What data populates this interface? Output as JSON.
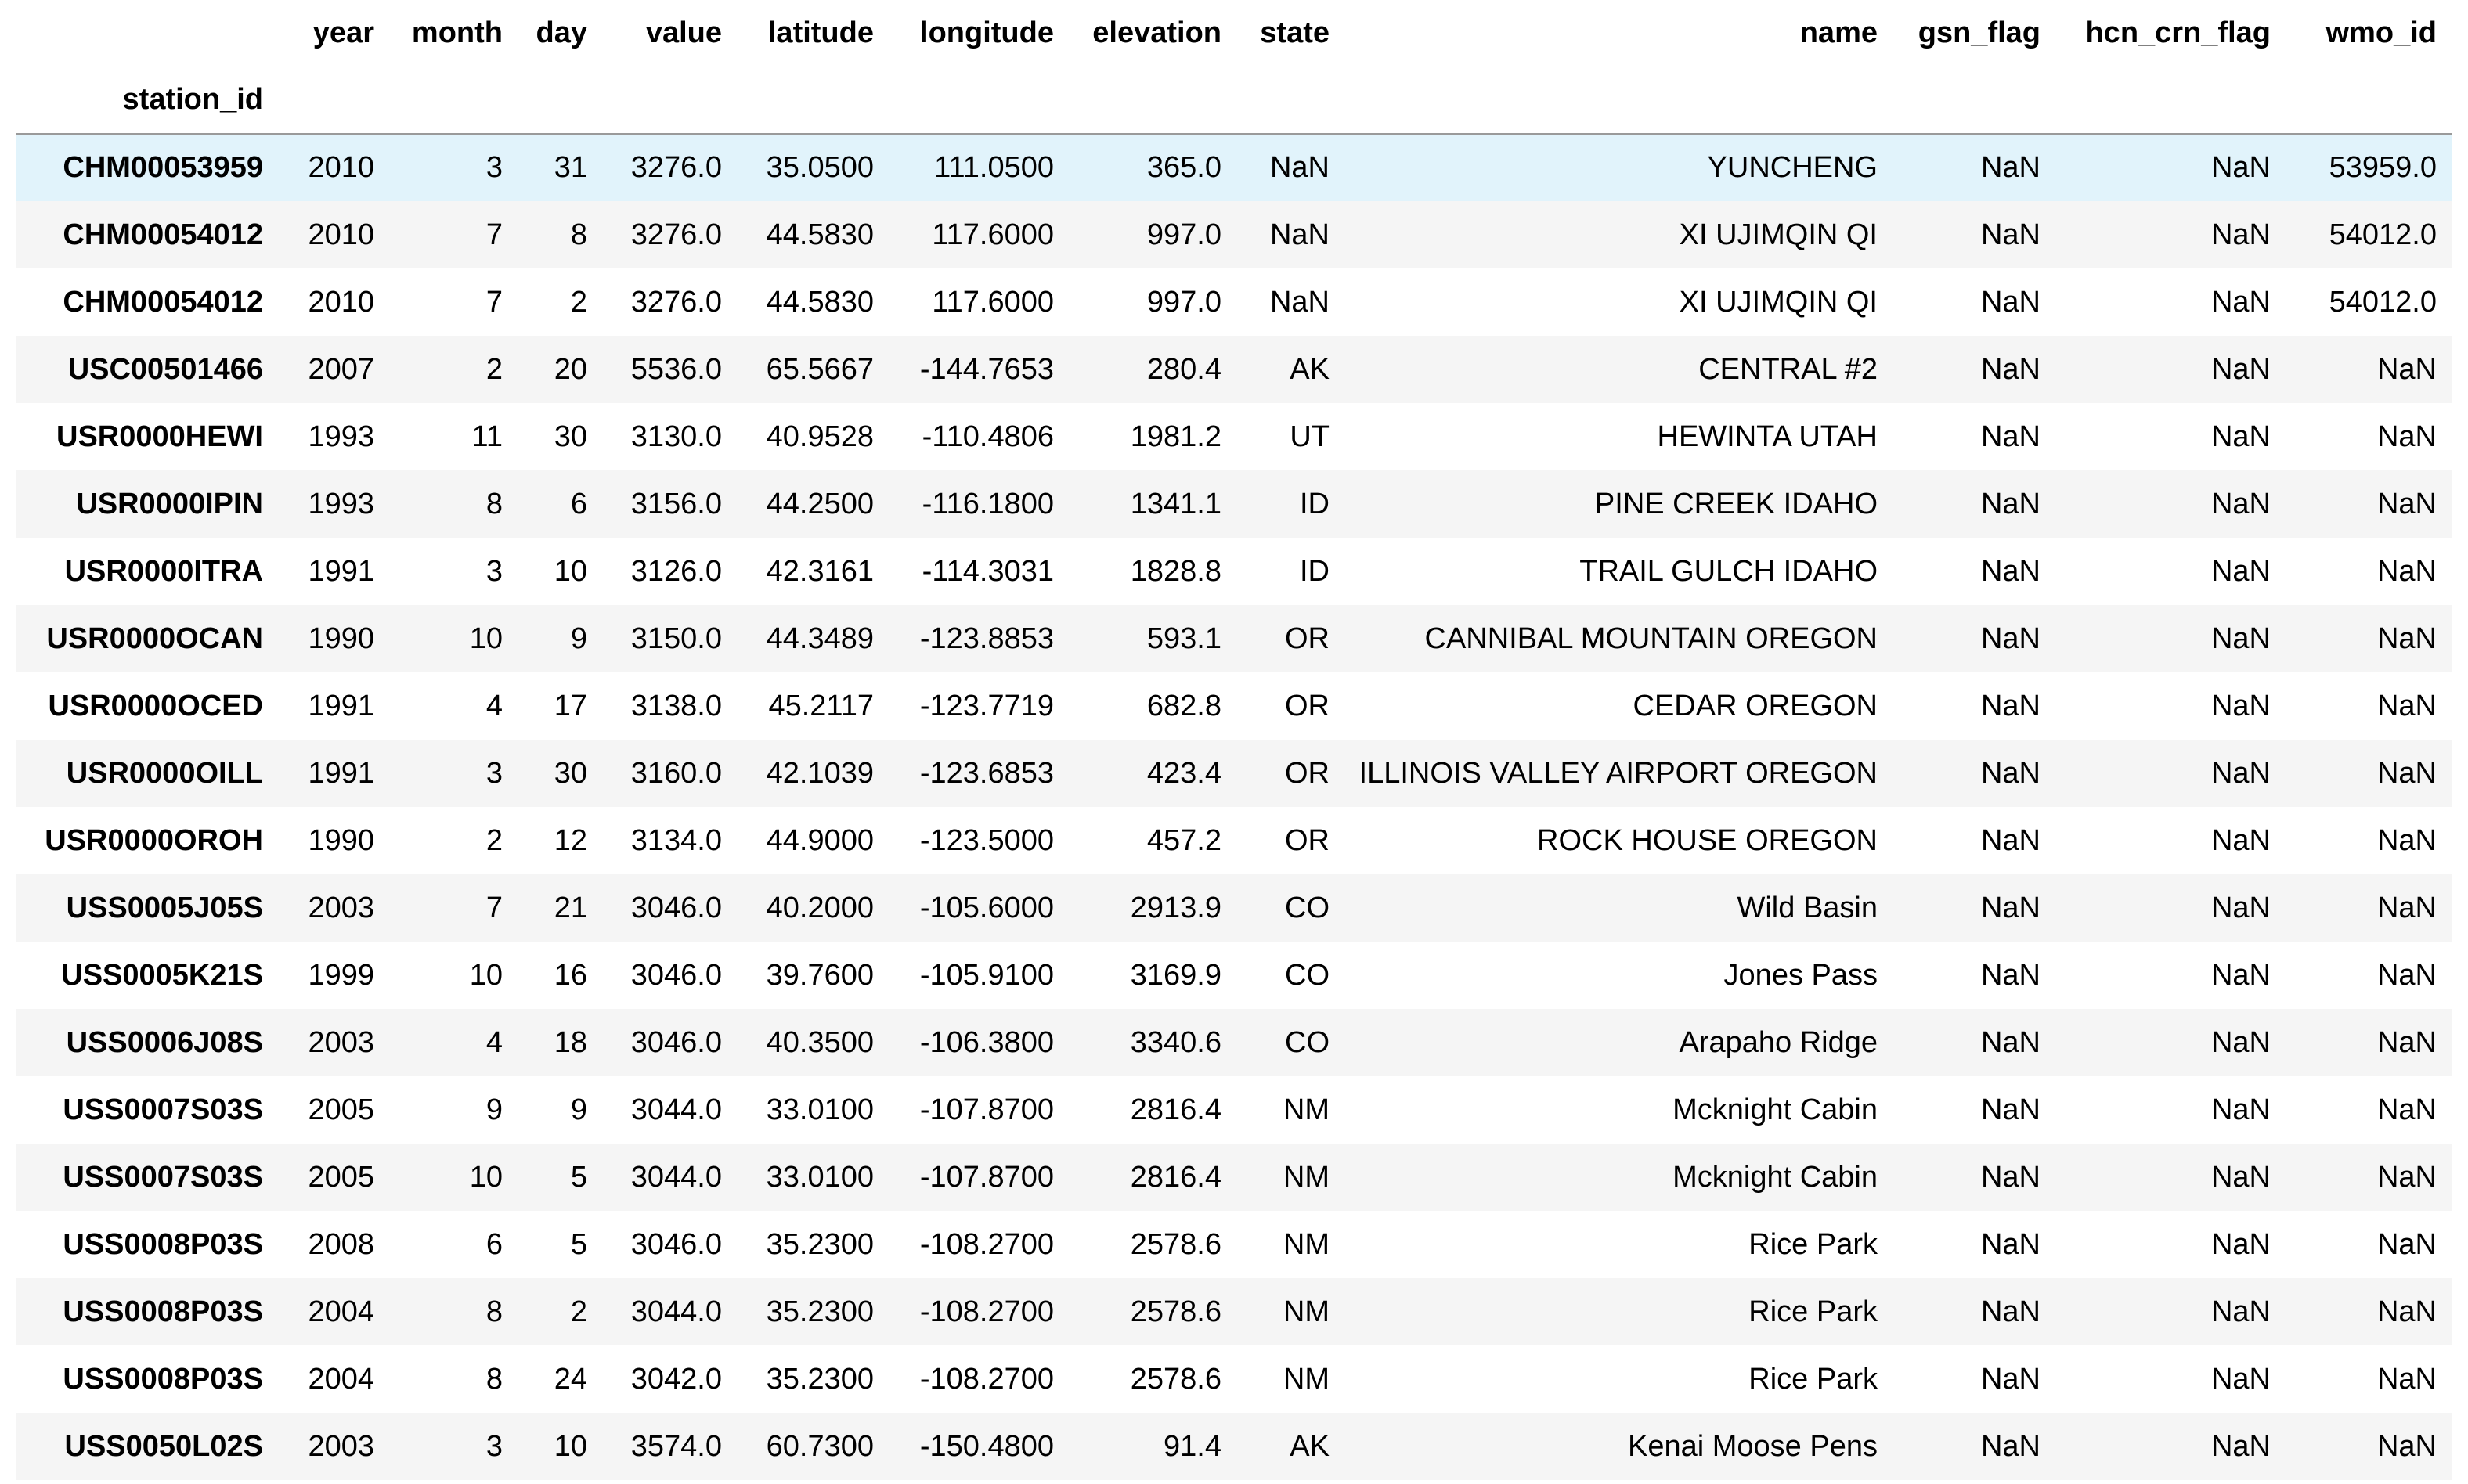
{
  "table": {
    "index_name": "station_id",
    "columns": [
      "year",
      "month",
      "day",
      "value",
      "latitude",
      "longitude",
      "elevation",
      "state",
      "name",
      "gsn_flag",
      "hcn_crn_flag",
      "wmo_id"
    ],
    "rows": [
      {
        "station_id": "CHM00053959",
        "cells": [
          "2010",
          "3",
          "31",
          "3276.0",
          "35.0500",
          "111.0500",
          "365.0",
          "NaN",
          "YUNCHENG",
          "NaN",
          "NaN",
          "53959.0"
        ]
      },
      {
        "station_id": "CHM00054012",
        "cells": [
          "2010",
          "7",
          "8",
          "3276.0",
          "44.5830",
          "117.6000",
          "997.0",
          "NaN",
          "XI UJIMQIN QI",
          "NaN",
          "NaN",
          "54012.0"
        ]
      },
      {
        "station_id": "CHM00054012",
        "cells": [
          "2010",
          "7",
          "2",
          "3276.0",
          "44.5830",
          "117.6000",
          "997.0",
          "NaN",
          "XI UJIMQIN QI",
          "NaN",
          "NaN",
          "54012.0"
        ]
      },
      {
        "station_id": "USC00501466",
        "cells": [
          "2007",
          "2",
          "20",
          "5536.0",
          "65.5667",
          "-144.7653",
          "280.4",
          "AK",
          "CENTRAL #2",
          "NaN",
          "NaN",
          "NaN"
        ]
      },
      {
        "station_id": "USR0000HEWI",
        "cells": [
          "1993",
          "11",
          "30",
          "3130.0",
          "40.9528",
          "-110.4806",
          "1981.2",
          "UT",
          "HEWINTA UTAH",
          "NaN",
          "NaN",
          "NaN"
        ]
      },
      {
        "station_id": "USR0000IPIN",
        "cells": [
          "1993",
          "8",
          "6",
          "3156.0",
          "44.2500",
          "-116.1800",
          "1341.1",
          "ID",
          "PINE CREEK IDAHO",
          "NaN",
          "NaN",
          "NaN"
        ]
      },
      {
        "station_id": "USR0000ITRA",
        "cells": [
          "1991",
          "3",
          "10",
          "3126.0",
          "42.3161",
          "-114.3031",
          "1828.8",
          "ID",
          "TRAIL GULCH IDAHO",
          "NaN",
          "NaN",
          "NaN"
        ]
      },
      {
        "station_id": "USR0000OCAN",
        "cells": [
          "1990",
          "10",
          "9",
          "3150.0",
          "44.3489",
          "-123.8853",
          "593.1",
          "OR",
          "CANNIBAL MOUNTAIN OREGON",
          "NaN",
          "NaN",
          "NaN"
        ]
      },
      {
        "station_id": "USR0000OCED",
        "cells": [
          "1991",
          "4",
          "17",
          "3138.0",
          "45.2117",
          "-123.7719",
          "682.8",
          "OR",
          "CEDAR OREGON",
          "NaN",
          "NaN",
          "NaN"
        ]
      },
      {
        "station_id": "USR0000OILL",
        "cells": [
          "1991",
          "3",
          "30",
          "3160.0",
          "42.1039",
          "-123.6853",
          "423.4",
          "OR",
          "ILLINOIS VALLEY AIRPORT OREGON",
          "NaN",
          "NaN",
          "NaN"
        ]
      },
      {
        "station_id": "USR0000OROH",
        "cells": [
          "1990",
          "2",
          "12",
          "3134.0",
          "44.9000",
          "-123.5000",
          "457.2",
          "OR",
          "ROCK HOUSE OREGON",
          "NaN",
          "NaN",
          "NaN"
        ]
      },
      {
        "station_id": "USS0005J05S",
        "cells": [
          "2003",
          "7",
          "21",
          "3046.0",
          "40.2000",
          "-105.6000",
          "2913.9",
          "CO",
          "Wild Basin",
          "NaN",
          "NaN",
          "NaN"
        ]
      },
      {
        "station_id": "USS0005K21S",
        "cells": [
          "1999",
          "10",
          "16",
          "3046.0",
          "39.7600",
          "-105.9100",
          "3169.9",
          "CO",
          "Jones Pass",
          "NaN",
          "NaN",
          "NaN"
        ]
      },
      {
        "station_id": "USS0006J08S",
        "cells": [
          "2003",
          "4",
          "18",
          "3046.0",
          "40.3500",
          "-106.3800",
          "3340.6",
          "CO",
          "Arapaho Ridge",
          "NaN",
          "NaN",
          "NaN"
        ]
      },
      {
        "station_id": "USS0007S03S",
        "cells": [
          "2005",
          "9",
          "9",
          "3044.0",
          "33.0100",
          "-107.8700",
          "2816.4",
          "NM",
          "Mcknight Cabin",
          "NaN",
          "NaN",
          "NaN"
        ]
      },
      {
        "station_id": "USS0007S03S",
        "cells": [
          "2005",
          "10",
          "5",
          "3044.0",
          "33.0100",
          "-107.8700",
          "2816.4",
          "NM",
          "Mcknight Cabin",
          "NaN",
          "NaN",
          "NaN"
        ]
      },
      {
        "station_id": "USS0008P03S",
        "cells": [
          "2008",
          "6",
          "5",
          "3046.0",
          "35.2300",
          "-108.2700",
          "2578.6",
          "NM",
          "Rice Park",
          "NaN",
          "NaN",
          "NaN"
        ]
      },
      {
        "station_id": "USS0008P03S",
        "cells": [
          "2004",
          "8",
          "2",
          "3044.0",
          "35.2300",
          "-108.2700",
          "2578.6",
          "NM",
          "Rice Park",
          "NaN",
          "NaN",
          "NaN"
        ]
      },
      {
        "station_id": "USS0008P03S",
        "cells": [
          "2004",
          "8",
          "24",
          "3042.0",
          "35.2300",
          "-108.2700",
          "2578.6",
          "NM",
          "Rice Park",
          "NaN",
          "NaN",
          "NaN"
        ]
      },
      {
        "station_id": "USS0050L02S",
        "cells": [
          "2003",
          "3",
          "10",
          "3574.0",
          "60.7300",
          "-150.4800",
          "91.4",
          "AK",
          "Kenai Moose Pens",
          "NaN",
          "NaN",
          "NaN"
        ]
      }
    ],
    "hovered_row": 0,
    "colors": {
      "hover_row_bg": "#e1f3fb",
      "stripe_row_bg": "#f5f5f5",
      "header_rule": "#9a9a9a"
    }
  }
}
